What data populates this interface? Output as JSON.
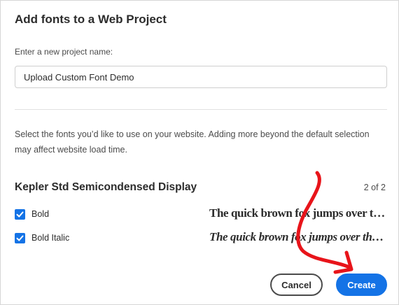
{
  "dialog": {
    "title": "Add fonts to a Web Project",
    "project_name_label": "Enter a new project name:",
    "project_name_value": "Upload Custom Font Demo",
    "description": "Select the fonts you’d like to use on your website. Adding more beyond the default selection may affect website load time."
  },
  "font_family": {
    "name": "Kepler Std Semicondensed Display",
    "count": "2 of 2",
    "styles": [
      {
        "label": "Bold",
        "checked": true,
        "sample": "The quick brown fox jumps over the lazy dog"
      },
      {
        "label": "Bold Italic",
        "checked": true,
        "sample": "The quick brown fox jumps over the lazy dog"
      }
    ]
  },
  "buttons": {
    "cancel": "Cancel",
    "create": "Create"
  },
  "colors": {
    "accent": "#1473e6",
    "annotation": "#e8141a"
  },
  "icons": {
    "checkbox_check": "checkmark-icon",
    "annotation": "hand-drawn-arrow"
  }
}
